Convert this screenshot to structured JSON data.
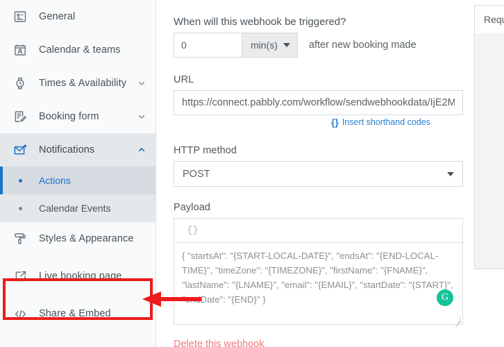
{
  "sidebar": {
    "items": [
      {
        "label": "General",
        "icon": "id-card-icon",
        "chevron": false
      },
      {
        "label": "Calendar & teams",
        "icon": "calendar-person-icon",
        "chevron": false
      },
      {
        "label": "Times & Availability",
        "icon": "watch-icon",
        "chevron": true,
        "chevron_dir": "down"
      },
      {
        "label": "Booking form",
        "icon": "form-edit-icon",
        "chevron": true,
        "chevron_dir": "down"
      },
      {
        "label": "Notifications",
        "icon": "envelope-alert-icon",
        "chevron": true,
        "chevron_dir": "up",
        "expanded": true
      }
    ],
    "sub_items": [
      {
        "label": "Actions",
        "active": true
      },
      {
        "label": "Calendar Events",
        "active": false
      }
    ],
    "items_after": [
      {
        "label": "Styles & Appearance",
        "icon": "paint-roller-icon",
        "chevron": false
      },
      {
        "label": "Live booking page",
        "icon": "external-link-icon",
        "chevron": false,
        "highlighted": true
      },
      {
        "label": "Share & Embed",
        "icon": "code-brackets-icon",
        "chevron": false
      }
    ]
  },
  "main": {
    "trigger_question": "When will this webhook be triggered?",
    "delay_value": "0",
    "delay_unit": "min(s)",
    "after_text": "after new booking made",
    "url_label": "URL",
    "url_value": "https://connect.pabbly.com/workflow/sendwebhookdata/IjE2M",
    "shorthand_link": "Insert shorthand codes",
    "shorthand_icon": "curly-braces-icon",
    "http_label": "HTTP method",
    "http_value": "POST",
    "payload_label": "Payload",
    "payload_placeholder": "{}",
    "payload_value": "{ \"startsAt\": \"{START-LOCAL-DATE}\", \"endsAt\": \"{END-LOCAL-TIME}\", \"timeZone\": \"{TIMEZONE}\", \"firstName\": \"{FNAME}\", \"lastName\": \"{LNAME}\", \"email\": \"{EMAIL}\", \"startDate\": \"{START}\", \"endDate\": \"{END}\" }",
    "grammarly_letter": "G",
    "delete_link": "Delete this webhook"
  },
  "right_panel": {
    "tab_label": "Requ"
  },
  "colors": {
    "accent_blue": "#1a73c8",
    "link_blue": "#2b7fd0",
    "danger_red": "#f07b7b",
    "annotation_red": "#ee1c1c",
    "grammarly_teal": "#15c39a"
  }
}
